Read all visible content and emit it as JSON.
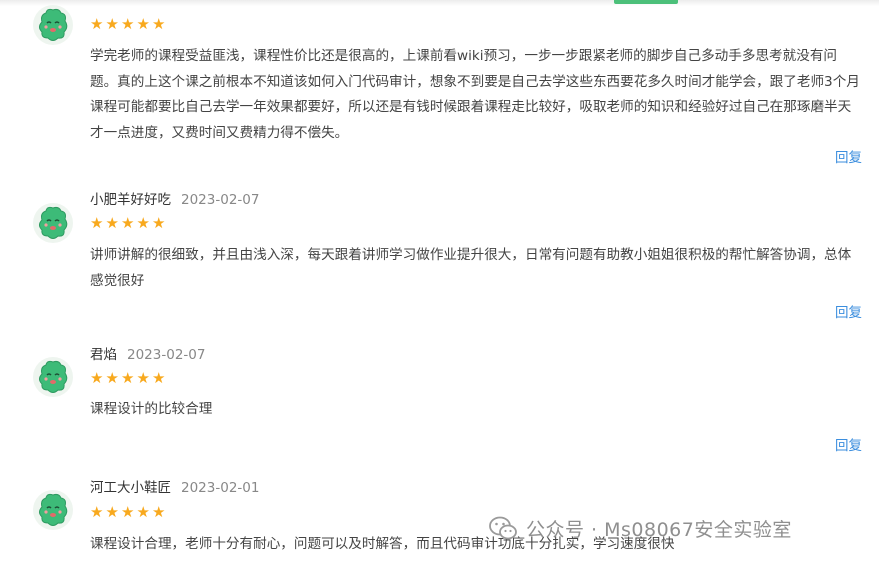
{
  "reviews": [
    {
      "user": "",
      "date": "",
      "rating": 5,
      "stars": "★★★★★",
      "content": "学完老师的课程受益匪浅，课程性价比还是很高的，上课前看wiki预习，一步一步跟紧老师的脚步自己多动手多思考就没有问题。真的上这个课之前根本不知道该如何入门代码审计，想象不到要是自己去学这些东西要花多久时间才能学会，跟了老师3个月课程可能都要比自己去学一年效果都要好，所以还是有钱时候跟着课程走比较好，吸取老师的知识和经验好过自己在那琢磨半天才一点进度，又费时间又费精力得不偿失。",
      "reply_label": "回复"
    },
    {
      "user": "小肥羊好好吃",
      "date": "2023-02-07",
      "rating": 5,
      "stars": "★★★★★",
      "content": "讲师讲解的很细致，并且由浅入深，每天跟着讲师学习做作业提升很大，日常有问题有助教小姐姐很积极的帮忙解答协调，总体感觉很好",
      "reply_label": "回复"
    },
    {
      "user": "君焰",
      "date": "2023-02-07",
      "rating": 5,
      "stars": "★★★★★",
      "content": "课程设计的比较合理",
      "reply_label": "回复"
    },
    {
      "user": "河工大小鞋匠",
      "date": "2023-02-01",
      "rating": 5,
      "stars": "★★★★★",
      "content": "课程设计合理，老师十分有耐心，问题可以及时解答，而且代码审计功底十分扎实，学习速度很快",
      "reply_label": ""
    }
  ],
  "watermark": {
    "text": "公众号 · Ms08067安全实验室",
    "icon": "wechat-icon"
  },
  "colors": {
    "star": "#f8a91e",
    "reply_link": "#3b8ede",
    "avatar_green": "#3dbb78",
    "tab_indicator": "#4cc07a"
  }
}
